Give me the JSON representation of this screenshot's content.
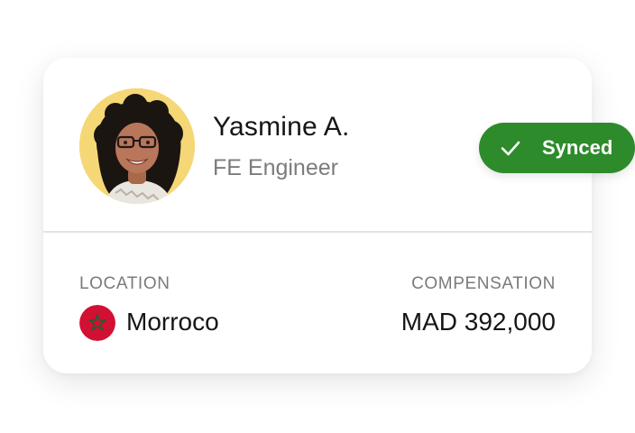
{
  "profile": {
    "name": "Yasmine A.",
    "role": "FE Engineer",
    "avatar_bg": "#f5d776"
  },
  "status": {
    "label": "Synced",
    "icon": "check-icon",
    "color": "#2e8b2b"
  },
  "location": {
    "label": "LOCATION",
    "value": "Morroco",
    "flag_icon": "morocco-flag-icon"
  },
  "compensation": {
    "label": "COMPENSATION",
    "value": "MAD 392,000"
  }
}
